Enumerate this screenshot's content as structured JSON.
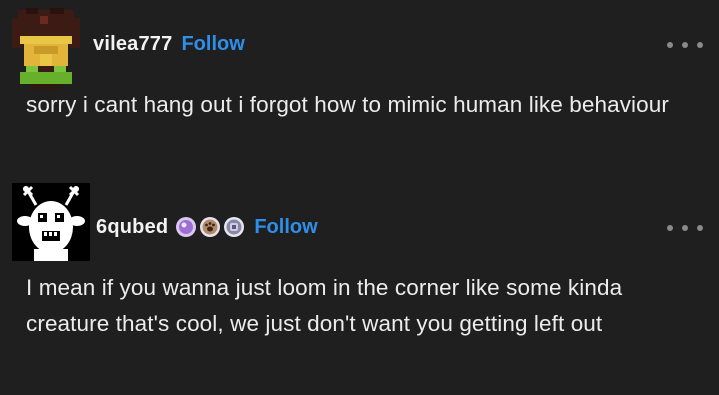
{
  "posts": [
    {
      "username": "vilea777",
      "follow_label": "Follow",
      "avatar_icon": "pixel-character-icon",
      "text": "sorry i cant hang out i forgot how to mimic human like behaviour"
    },
    {
      "username": "6qubed",
      "follow_label": "Follow",
      "avatar_icon": "goat-monster-icon",
      "badges": [
        "purple-badge-icon",
        "paw-badge-icon",
        "shell-badge-icon"
      ],
      "text": "I mean if you wanna just loom in the corner like some kinda creature that's cool, we just don't want you getting left out"
    }
  ],
  "colors": {
    "background": "#1f1f20",
    "link": "#2f8fe8",
    "text": "#ececec"
  }
}
